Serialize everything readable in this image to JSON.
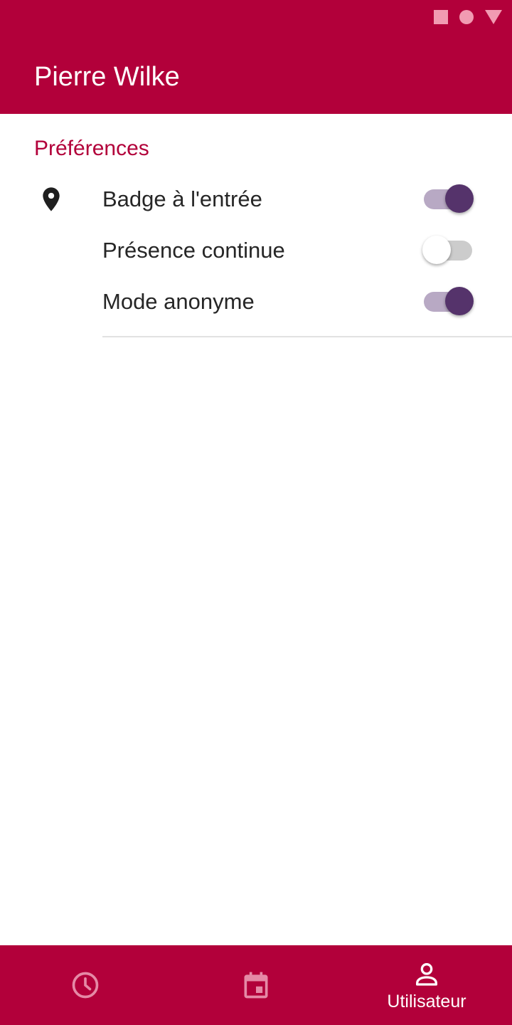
{
  "status_bar": {
    "icons": [
      "square-icon",
      "circle-icon",
      "triangle-icon"
    ]
  },
  "header": {
    "title": "Pierre Wilke"
  },
  "preferences": {
    "section_title": "Préférences",
    "icon": "location-pin-icon",
    "items": [
      {
        "label": "Badge à l'entrée",
        "enabled": true
      },
      {
        "label": "Présence continue",
        "enabled": false
      },
      {
        "label": "Mode anonyme",
        "enabled": true
      }
    ]
  },
  "bottom_nav": {
    "items": [
      {
        "icon": "clock-icon",
        "label": "",
        "active": false
      },
      {
        "icon": "calendar-icon",
        "label": "",
        "active": false
      },
      {
        "icon": "user-icon",
        "label": "Utilisateur",
        "active": true
      }
    ]
  },
  "colors": {
    "primary": "#b2003a",
    "switch_on_thumb": "#55336b",
    "switch_on_track": "#b8a9c4",
    "inactive_nav_icon": "#e58aa6"
  }
}
